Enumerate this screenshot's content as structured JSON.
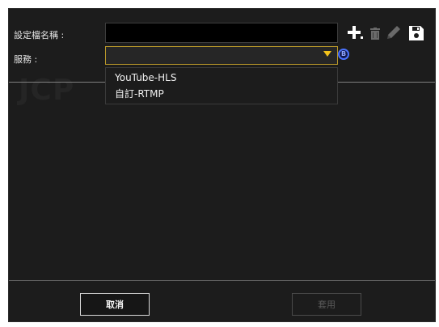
{
  "form": {
    "profile_name_label": "設定檔名稱 :",
    "profile_name_value": "",
    "service_label": "服務 :",
    "service_value": ""
  },
  "toolbar": {
    "icons": [
      "plus-icon",
      "trash-icon",
      "pencil-icon",
      "save-icon"
    ]
  },
  "info_badge": "B",
  "dropdown": {
    "options": [
      "YouTube-HLS",
      "自訂-RTMP"
    ]
  },
  "watermark": "JCP",
  "buttons": {
    "cancel_label": "取消",
    "apply_label": "套用"
  },
  "colors": {
    "dialog_background": "#1c1c1c",
    "select_accent": "#f2c21b",
    "info_blue": "#4b73ff",
    "disabled_text": "#5a5a5a"
  }
}
